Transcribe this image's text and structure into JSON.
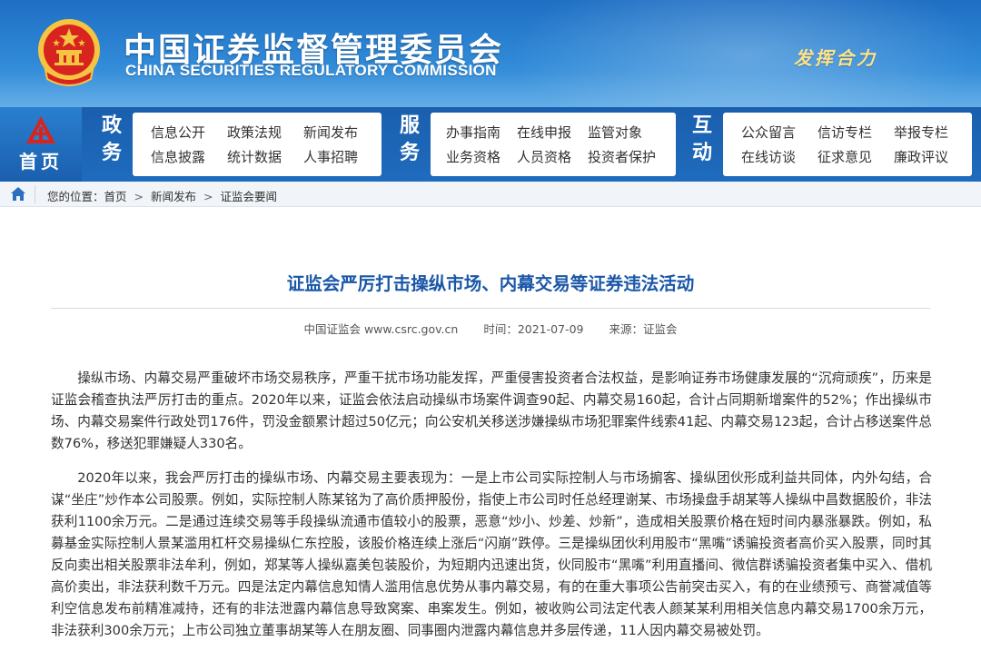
{
  "header": {
    "title_cn": "中国证券监督管理委员会",
    "title_en": "CHINA SECURITIES REGULATORY COMMISSION",
    "slogan": "发挥合力",
    "colors": {
      "banner": "#2f88d6",
      "nav": "#1a5fae",
      "slogan": "#ffe28a",
      "emblem_red": "#d8241f",
      "emblem_gold": "#f5c542"
    }
  },
  "nav": {
    "home_label": "首页",
    "sections": [
      {
        "label": [
          "政",
          "务"
        ],
        "rows": [
          [
            "信息公开",
            "政策法规",
            "新闻发布"
          ],
          [
            "信息披露",
            "统计数据",
            "人事招聘"
          ]
        ]
      },
      {
        "label": [
          "服",
          "务"
        ],
        "rows": [
          [
            "办事指南",
            "在线申报",
            "监管对象"
          ],
          [
            "业务资格",
            "人员资格",
            "投资者保护"
          ]
        ]
      },
      {
        "label": [
          "互",
          "动"
        ],
        "rows": [
          [
            "公众留言",
            "信访专栏",
            "举报专栏"
          ],
          [
            "在线访谈",
            "征求意见",
            "廉政评议"
          ]
        ]
      }
    ]
  },
  "breadcrumb": {
    "prefix": "您的位置：",
    "items": [
      "首页",
      "新闻发布",
      "证监会要闻"
    ],
    "separator": ">"
  },
  "article": {
    "title": "证监会严厉打击操纵市场、内幕交易等证券违法活动",
    "source": "中国证监会 www.csrc.gov.cn",
    "time": "时间：2021-07-09",
    "origin": "来源：证监会",
    "paragraphs": [
      "操纵市场、内幕交易严重破坏市场交易秩序，严重干扰市场功能发挥，严重侵害投资者合法权益，是影响证券市场健康发展的“沉疴顽疾”，历来是证监会稽查执法严厉打击的重点。2020年以来，证监会依法启动操纵市场案件调查90起、内幕交易160起，合计占同期新增案件的52%；作出操纵市场、内幕交易案件行政处罚176件，罚没金额累计超过50亿元；向公安机关移送涉嫌操纵市场犯罪案件线索41起、内幕交易123起，合计占移送案件总数76%，移送犯罪嫌疑人330名。",
      "2020年以来，我会严厉打击的操纵市场、内幕交易主要表现为：一是上市公司实际控制人与市场掮客、操纵团伙形成利益共同体，内外勾结，合谋“坐庄”炒作本公司股票。例如，实际控制人陈某铭为了高价质押股份，指使上市公司时任总经理谢某、市场操盘手胡某等人操纵中昌数据股价，非法获利1100余万元。二是通过连续交易等手段操纵流通市值较小的股票，恶意“炒小、炒差、炒新”，造成相关股票价格在短时间内暴涨暴跌。例如，私募基金实际控制人景某滥用杠杆交易操纵仁东控股，该股价格连续上涨后“闪崩”跌停。三是操纵团伙利用股市“黑嘴”诱骗投资者高价买入股票，同时其反向卖出相关股票非法牟利，例如，郑某等人操纵嘉美包装股价，为短期内迅速出货，伙同股市“黑嘴”利用直播间、微信群诱骗投资者集中买入、借机高价卖出，非法获利数千万元。四是法定内幕信息知情人滥用信息优势从事内幕交易，有的在重大事项公告前突击买入，有的在业绩预亏、商誉减值等利空信息发布前精准减持，还有的非法泄露内幕信息导致窝案、串案发生。例如，被收购公司法定代表人颜某某利用相关信息内幕交易1700余万元，非法获利300余万元；上市公司独立董事胡某等人在朋友圈、同事圈内泄露内幕信息并多层传递，11人因内幕交易被处罚。"
    ],
    "title_color": "#1a57a8"
  }
}
